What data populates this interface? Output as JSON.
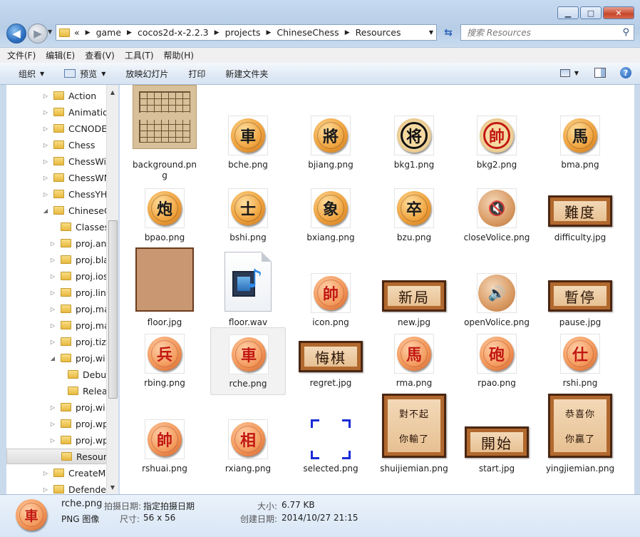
{
  "window": {
    "buttons": {
      "minimize": "▁",
      "maximize": "□",
      "close": "✕"
    }
  },
  "address": {
    "prefix": "«",
    "crumbs": [
      "game",
      "cocos2d-x-2.2.3",
      "projects",
      "ChineseChess",
      "Resources"
    ],
    "search_placeholder": "搜索 Resources"
  },
  "menu": [
    "文件(F)",
    "编辑(E)",
    "查看(V)",
    "工具(T)",
    "帮助(H)"
  ],
  "toolbar": {
    "organize": "组织",
    "preview": "预览",
    "slideshow": "放映幻灯片",
    "print": "打印",
    "new_folder": "新建文件夹"
  },
  "tree": [
    {
      "label": "Action",
      "level": 1,
      "expander": "▷"
    },
    {
      "label": "Animatio",
      "level": 1,
      "expander": "▷"
    },
    {
      "label": "CCNODE",
      "level": 1,
      "expander": "▷"
    },
    {
      "label": "Chess",
      "level": 1,
      "expander": "▷"
    },
    {
      "label": "ChessWi",
      "level": 1,
      "expander": "▷"
    },
    {
      "label": "ChessWN",
      "level": 1,
      "expander": "▷"
    },
    {
      "label": "ChessYH",
      "level": 1,
      "expander": "▷"
    },
    {
      "label": "ChineseC",
      "level": 1,
      "expander": "◢"
    },
    {
      "label": "Classes",
      "level": 2,
      "expander": ""
    },
    {
      "label": "proj.an",
      "level": 2,
      "expander": "▷"
    },
    {
      "label": "proj.bla",
      "level": 2,
      "expander": "▷"
    },
    {
      "label": "proj.ios",
      "level": 2,
      "expander": "▷"
    },
    {
      "label": "proj.lin",
      "level": 2,
      "expander": "▷"
    },
    {
      "label": "proj.ma",
      "level": 2,
      "expander": "▷"
    },
    {
      "label": "proj.ma",
      "level": 2,
      "expander": "▷"
    },
    {
      "label": "proj.tiz",
      "level": 2,
      "expander": "▷"
    },
    {
      "label": "proj.wi",
      "level": 2,
      "expander": "◢"
    },
    {
      "label": "Debu",
      "level": 3,
      "expander": ""
    },
    {
      "label": "Relea",
      "level": 3,
      "expander": ""
    },
    {
      "label": "proj.wi",
      "level": 2,
      "expander": "▷"
    },
    {
      "label": "proj.wp",
      "level": 2,
      "expander": "▷"
    },
    {
      "label": "proj.wp",
      "level": 2,
      "expander": "▷"
    },
    {
      "label": "Resour",
      "level": 2,
      "expander": "",
      "selected": true
    },
    {
      "label": "CreateM",
      "level": 1,
      "expander": "▷"
    },
    {
      "label": "Defende",
      "level": 1,
      "expander": "▷"
    }
  ],
  "files": [
    {
      "name": "background.png",
      "label_line1": "background.pn",
      "label_line2": "g",
      "kind": "board"
    },
    {
      "name": "bche.png",
      "kind": "piece-black",
      "glyph": "車"
    },
    {
      "name": "bjiang.png",
      "kind": "piece-black",
      "glyph": "將"
    },
    {
      "name": "bkg1.png",
      "kind": "bkg1",
      "glyph": "将"
    },
    {
      "name": "bkg2.png",
      "kind": "bkg2",
      "glyph": "帥"
    },
    {
      "name": "bma.png",
      "kind": "piece-black",
      "glyph": "馬"
    },
    {
      "name": "bpao.png",
      "kind": "piece-black",
      "glyph": "炮"
    },
    {
      "name": "bshi.png",
      "kind": "piece-black",
      "glyph": "士"
    },
    {
      "name": "bxiang.png",
      "kind": "piece-black",
      "glyph": "象"
    },
    {
      "name": "bzu.png",
      "kind": "piece-black",
      "glyph": "卒"
    },
    {
      "name": "closeVolice.png",
      "kind": "sound-off"
    },
    {
      "name": "difficulty.jpg",
      "kind": "plaque",
      "text": "難度"
    },
    {
      "name": "floor.jpg",
      "kind": "floor"
    },
    {
      "name": "floor.wav",
      "kind": "wav"
    },
    {
      "name": "icon.png",
      "kind": "piece-red",
      "glyph": "帥"
    },
    {
      "name": "new.jpg",
      "kind": "plaque",
      "text": "新局"
    },
    {
      "name": "openVolice.png",
      "kind": "sound-on"
    },
    {
      "name": "pause.jpg",
      "kind": "plaque",
      "text": "暫停"
    },
    {
      "name": "rbing.png",
      "kind": "piece-red",
      "glyph": "兵"
    },
    {
      "name": "rche.png",
      "kind": "piece-red",
      "glyph": "車",
      "selected": true
    },
    {
      "name": "regret.jpg",
      "kind": "plaque",
      "text": "悔棋"
    },
    {
      "name": "rma.png",
      "kind": "piece-red",
      "glyph": "馬"
    },
    {
      "name": "rpao.png",
      "kind": "piece-red",
      "glyph": "砲"
    },
    {
      "name": "rshi.png",
      "kind": "piece-red",
      "glyph": "仕"
    },
    {
      "name": "rshuai.png",
      "kind": "piece-red",
      "glyph": "帥"
    },
    {
      "name": "rxiang.png",
      "kind": "piece-red",
      "glyph": "相"
    },
    {
      "name": "selected.png",
      "kind": "selected"
    },
    {
      "name": "shuijiemian.png",
      "kind": "tall-plaque",
      "lines": [
        "對不起",
        "你輸了"
      ]
    },
    {
      "name": "start.jpg",
      "kind": "plaque",
      "text": "開始"
    },
    {
      "name": "yingjiemian.png",
      "kind": "tall-plaque",
      "lines": [
        "恭喜你",
        "你贏了"
      ]
    }
  ],
  "details": {
    "filename": "rche.png",
    "filetype": "PNG 图像",
    "date_taken_key": "拍摄日期:",
    "date_taken_val": "指定拍摄日期",
    "dims_key": "尺寸:",
    "dims_val": "56 x 56",
    "size_key": "大小:",
    "size_val": "6.77 KB",
    "created_key": "创建日期:",
    "created_val": "2014/10/27 21:15",
    "thumb_glyph": "車"
  }
}
